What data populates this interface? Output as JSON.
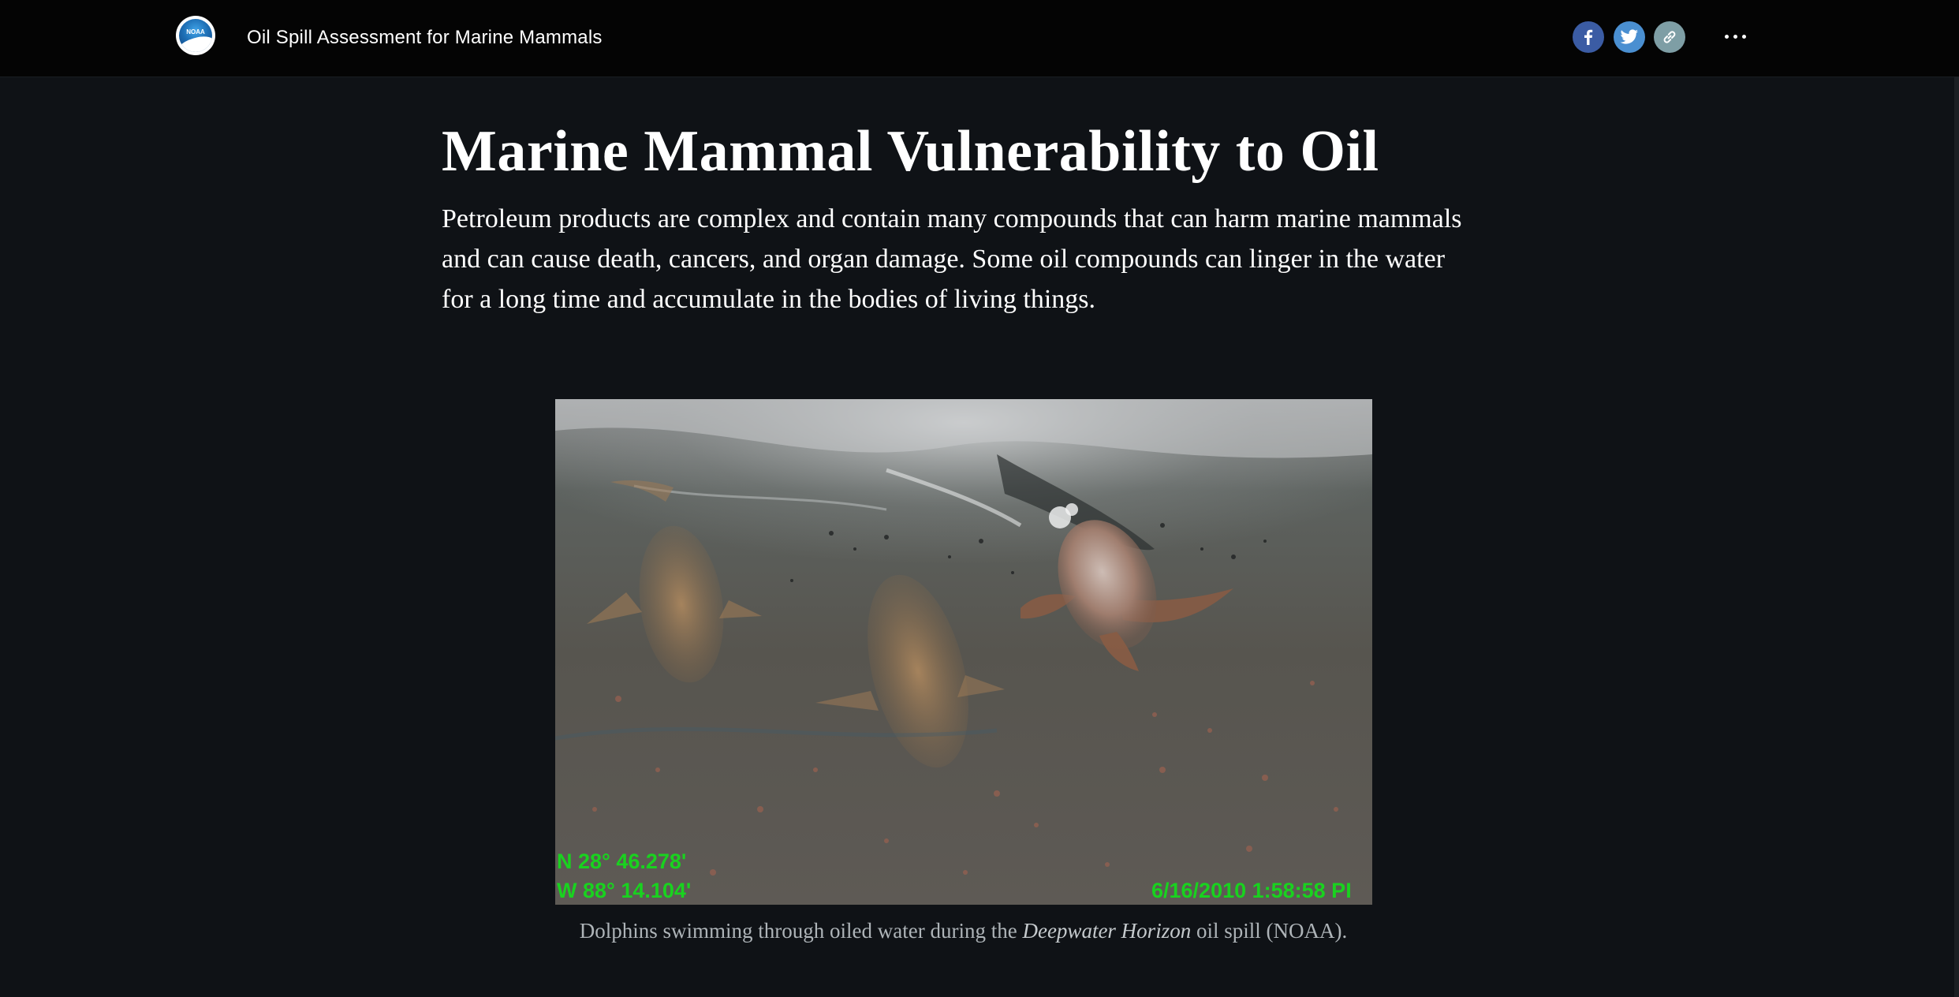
{
  "header": {
    "logo_text": "NOAA",
    "title": "Oil Spill Assessment for Marine Mammals",
    "share_icons": [
      "facebook-icon",
      "twitter-icon",
      "link-icon"
    ],
    "more_icon": "more-options-icon"
  },
  "article": {
    "heading": "Marine Mammal Vulnerability to Oil",
    "intro": "Petroleum products are complex and contain many compounds that can harm marine mammals and can cause death, cancers, and organ damage. Some oil compounds can linger in the water for a long time and accumulate in the bodies of living things."
  },
  "figure": {
    "overlay": {
      "lat": "N 28° 46.278'",
      "lon": "W 88° 14.104'",
      "timestamp": "6/16/2010 1:58:58 PI"
    },
    "caption_before": "Dolphins swimming through oiled water during the ",
    "caption_italic": "Deepwater Horizon",
    "caption_after": " oil spill (NOAA)."
  },
  "colors": {
    "page_background": "#0f1216",
    "topbar": "#040404",
    "facebook": "#3b5ca4",
    "twitter": "#4a8fd1",
    "link": "#7e9ea5",
    "overlay_text": "#19d21f"
  }
}
